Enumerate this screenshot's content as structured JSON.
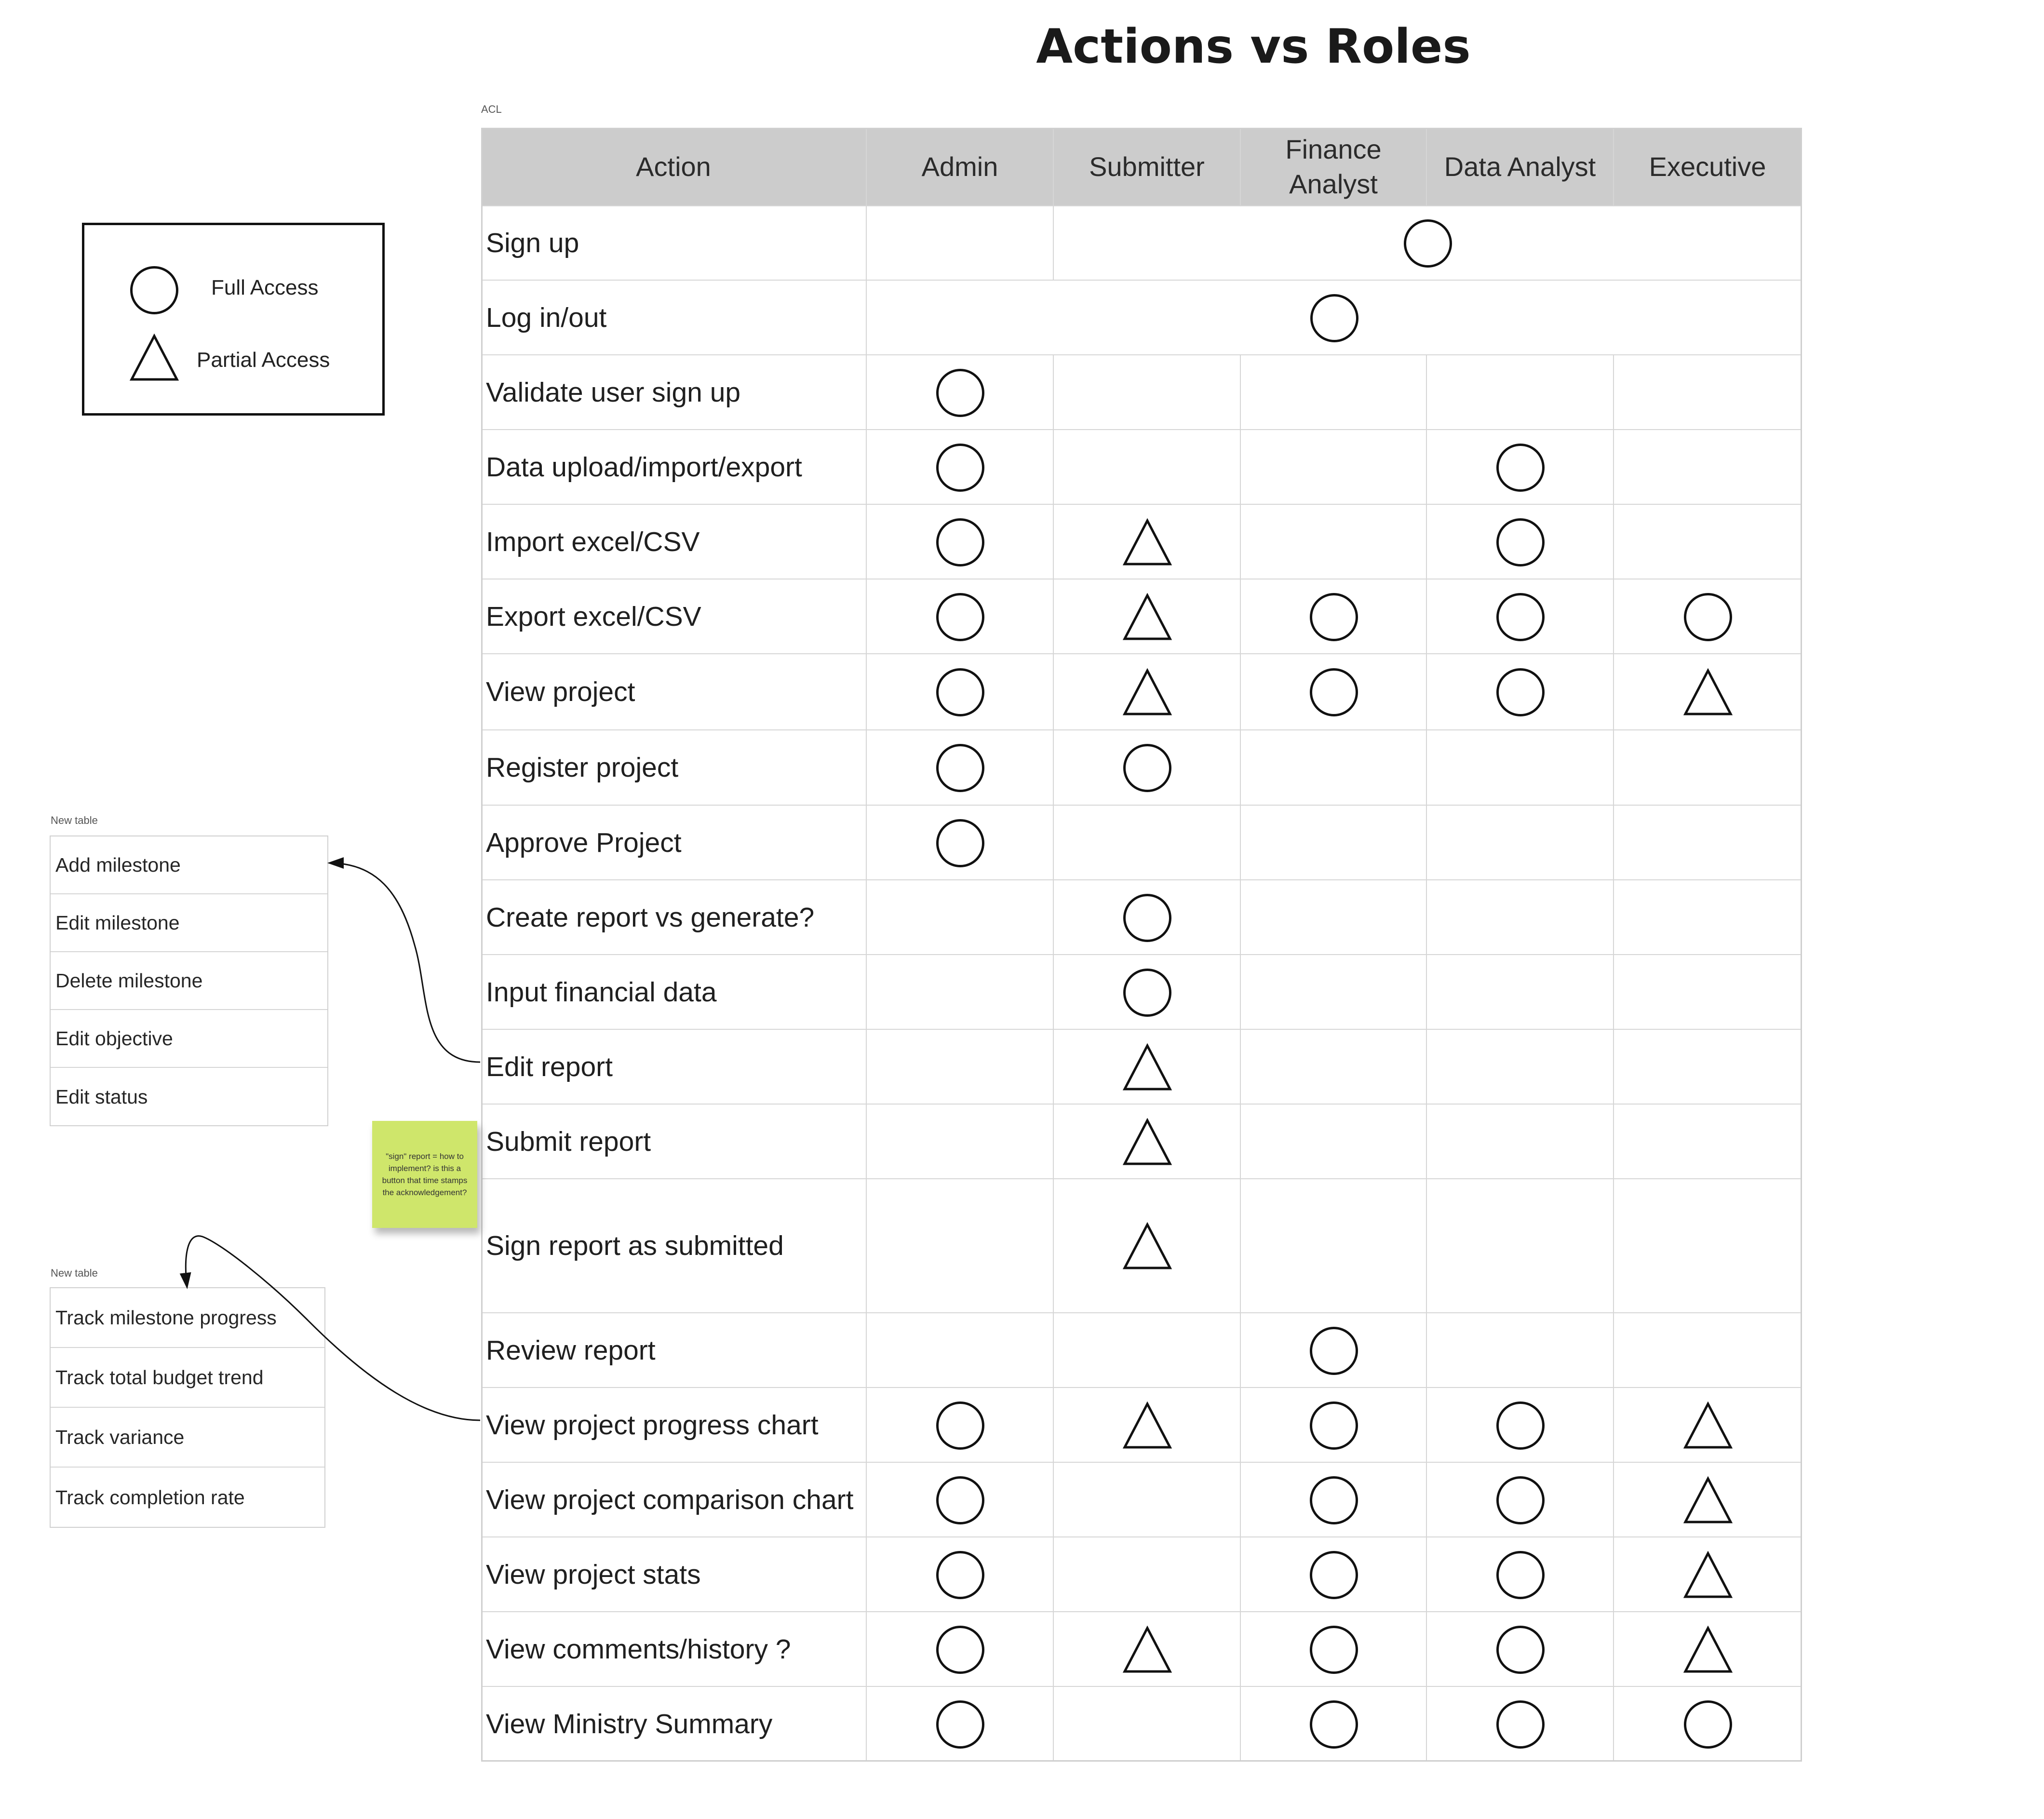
{
  "title": "Actions vs Roles",
  "acl_caption": "ACL",
  "legend": {
    "full": {
      "label": "Full Access",
      "icon": "circle-icon"
    },
    "partial": {
      "label": "Partial Access",
      "icon": "triangle-icon"
    }
  },
  "columns": [
    "Action",
    "Admin",
    "Submitter",
    "Finance Analyst",
    "Data Analyst",
    "Executive"
  ],
  "rows": [
    {
      "action": "Sign up",
      "marks": [
        "",
        "C",
        "C",
        "C",
        "C"
      ],
      "span_from": 1,
      "span_symbol": "C"
    },
    {
      "action": "Log in/out",
      "marks": [
        "C",
        "C",
        "C",
        "C",
        "C"
      ],
      "span_from": 0,
      "span_symbol": "C"
    },
    {
      "action": "Validate user sign up",
      "marks": [
        "C",
        "",
        "",
        "",
        ""
      ]
    },
    {
      "action": "Data upload/import/export",
      "marks": [
        "C",
        "",
        "",
        "C",
        ""
      ]
    },
    {
      "action": "Import excel/CSV",
      "marks": [
        "C",
        "T",
        "",
        "C",
        ""
      ]
    },
    {
      "action": "Export excel/CSV",
      "marks": [
        "C",
        "T",
        "C",
        "C",
        "C"
      ]
    },
    {
      "action": "View project",
      "marks": [
        "C",
        "T",
        "C",
        "C",
        "T"
      ]
    },
    {
      "action": "Register project",
      "marks": [
        "C",
        "C",
        "",
        "",
        ""
      ]
    },
    {
      "action": "Approve Project",
      "marks": [
        "C",
        "",
        "",
        "",
        ""
      ]
    },
    {
      "action": "Create report vs generate?",
      "marks": [
        "",
        "C",
        "",
        "",
        ""
      ]
    },
    {
      "action": "Input financial data",
      "marks": [
        "",
        "C",
        "",
        "",
        ""
      ]
    },
    {
      "action": "Edit report",
      "marks": [
        "",
        "T",
        "",
        "",
        ""
      ]
    },
    {
      "action": "Submit report",
      "marks": [
        "",
        "T",
        "",
        "",
        ""
      ]
    },
    {
      "action": "Sign report as submitted",
      "marks": [
        "",
        "T",
        "",
        "",
        ""
      ]
    },
    {
      "action": "Review report",
      "marks": [
        "",
        "",
        "C",
        "",
        ""
      ]
    },
    {
      "action": "View project progress chart",
      "marks": [
        "C",
        "T",
        "C",
        "C",
        "T"
      ]
    },
    {
      "action": "View project comparison chart",
      "marks": [
        "C",
        "",
        "C",
        "C",
        "T"
      ]
    },
    {
      "action": "View project stats",
      "marks": [
        "C",
        "",
        "C",
        "C",
        "T"
      ]
    },
    {
      "action": "View comments/history ?",
      "marks": [
        "C",
        "T",
        "C",
        "C",
        "T"
      ]
    },
    {
      "action": "View Ministry Summary",
      "marks": [
        "C",
        "",
        "C",
        "C",
        "C"
      ]
    }
  ],
  "milestone_table": {
    "caption": "New table",
    "items": [
      "Add milestone",
      "Edit milestone",
      "Delete milestone",
      "Edit objective",
      "Edit status"
    ]
  },
  "tracking_table": {
    "caption": "New table",
    "items": [
      "Track milestone progress",
      "Track total budget trend",
      "Track variance",
      "Track completion rate"
    ]
  },
  "sticky_note": "\"sign\" report = how to implement? is this a button that time stamps the acknowledgement?",
  "colors": {
    "header_bg": "#cccccc",
    "grid": "#d6d6d6",
    "sticky": "#cfe66b",
    "symbol": "#111111"
  }
}
